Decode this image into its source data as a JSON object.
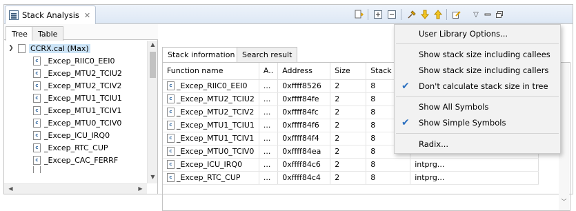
{
  "view": {
    "title": "Stack Analysis",
    "close_glyph": "✕"
  },
  "toolbar": {
    "icons": [
      "export-icon",
      "expand-all-icon",
      "collapse-all-icon",
      "pin-icon",
      "arrow-down-icon",
      "arrow-up-icon",
      "edit-icon",
      "view-menu-icon",
      "minimize-icon",
      "maximize-icon"
    ]
  },
  "left": {
    "tabs": [
      "Tree",
      "Table"
    ],
    "root": "CCRX.cal (Max)",
    "items": [
      "_Excep_RIIC0_EEI0",
      "_Excep_MTU2_TCIU2",
      "_Excep_MTU2_TCIV2",
      "_Excep_MTU1_TCIU1",
      "_Excep_MTU1_TCIV1",
      "_Excep_MTU0_TCIV0",
      "_Excep_ICU_IRQ0",
      "_Excep_RTC_CUP",
      "_Excep_CAC_FERRF"
    ]
  },
  "right": {
    "tabs": [
      "Stack information",
      "Search result"
    ],
    "columns": [
      "Function name",
      "A..",
      "Address",
      "Size",
      "Stack"
    ],
    "rows": [
      [
        "_Excep_RIIC0_EEI0",
        "...",
        "0xffff8526",
        "2",
        "8",
        ""
      ],
      [
        "_Excep_MTU2_TCIU2",
        "...",
        "0xffff84fe",
        "2",
        "8",
        ""
      ],
      [
        "_Excep_MTU2_TCIV2",
        "...",
        "0xffff84fc",
        "2",
        "8",
        ""
      ],
      [
        "_Excep_MTU1_TCIU1",
        "...",
        "0xffff84f6",
        "2",
        "8",
        ""
      ],
      [
        "_Excep_MTU1_TCIV1",
        "...",
        "0xffff84f4",
        "2",
        "8",
        ""
      ],
      [
        "_Excep_MTU0_TCIV0",
        "...",
        "0xffff84ea",
        "2",
        "8",
        ""
      ],
      [
        "_Excep_ICU_IRQ0",
        "...",
        "0xffff84c6",
        "2",
        "8",
        "intprg..."
      ],
      [
        "_Excep_RTC_CUP",
        "...",
        "0xffff84c4",
        "2",
        "8",
        "intprg..."
      ]
    ]
  },
  "menu": {
    "items": [
      {
        "label": "User Library Options...",
        "checked": false
      },
      {
        "label": "Show stack size including callees",
        "checked": false
      },
      {
        "label": "Show stack size including callers",
        "checked": false
      },
      {
        "label": "Don't calculate stack size in tree",
        "checked": true
      },
      {
        "label": "Show All Symbols",
        "checked": false
      },
      {
        "label": "Show Simple Symbols",
        "checked": true
      },
      {
        "label": "Radix...",
        "checked": false
      }
    ]
  },
  "colors": {
    "selection": "#cce4f7",
    "check": "#2a6fc0"
  }
}
